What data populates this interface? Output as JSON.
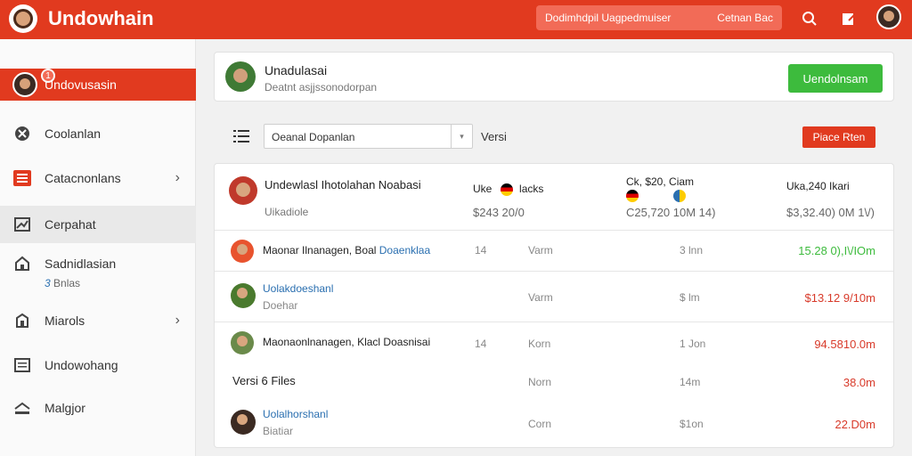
{
  "header": {
    "brand": "Undowhain",
    "search_placeholder": "Dodimhdpil Uagpedmuiser",
    "search_scope": "Cetnan Bac",
    "icons": [
      "search-icon",
      "edit-icon",
      "avatar"
    ]
  },
  "sidebar": {
    "items": [
      {
        "label": "Undovusasin",
        "icon": "avatar",
        "badge": "1",
        "active": true
      },
      {
        "label": "Coolanlan",
        "icon": "tools-icon"
      },
      {
        "label": "Catacnonlans",
        "icon": "list-icon",
        "chevron": true
      },
      {
        "label": "Cerpahat",
        "icon": "chart-icon",
        "hover": true
      },
      {
        "label": "Sadnidlasian",
        "sub": "Bnlas",
        "sub_prefix": "3",
        "icon": "home-icon"
      },
      {
        "label": "Miarols",
        "icon": "building-icon",
        "chevron": true
      },
      {
        "label": "Undowohang",
        "icon": "document-icon"
      },
      {
        "label": "Malgjor",
        "icon": "layers-icon"
      }
    ]
  },
  "profile": {
    "name": "Unadulasai",
    "subtitle": "Deatnt asjjssonodorpan",
    "button": "Uendolnsam"
  },
  "filter": {
    "select_value": "Oeanal Dopanlan",
    "label": "Versi",
    "button": "Piace Rten"
  },
  "table": {
    "header": {
      "title": "Undewlasl Ihotolahan Noabasi",
      "subtitle": "Uikadiole",
      "col1_label": "Uke",
      "col1_suffix": "lacks",
      "col1_value": "$243 20/0",
      "col2_label": "Ck, $20, Ciam",
      "col2_value": "C25,720 10M 14)",
      "col3_label": "Uka,240 Ikari",
      "col3_value": "$3,32.40) 0M 1\\/)"
    },
    "rows": [
      {
        "name": "Maonar Ilnanagen, Boal ",
        "name_hl": "Doaenklaa",
        "sub": "",
        "c1": "14",
        "c2": "Varm",
        "c3": "3 lnn",
        "amount": "15.28 0),I\\/IOm",
        "amount_color": "#3dbb3d",
        "avatar_color": "#e8532e"
      },
      {
        "name": "",
        "name_hl": "Uolakdoeshanl",
        "sub": "Doehar",
        "c1": "",
        "c2": "Varm",
        "c3": "$ lm",
        "amount": "$13.12 9/10m",
        "amount_color": "#d83a2a",
        "avatar_color": "#4a7a2e"
      },
      {
        "name": "Maonaonlnanagen, Klacl Doasnisai",
        "name_hl": "",
        "sub": "",
        "c1": "14",
        "c2": "Korn",
        "c3": "1 Jon",
        "amount": "94.5810.0m",
        "amount_color": "#d83a2a",
        "avatar_color": "#6a8a4a"
      },
      {
        "name": "Versi 6 Files",
        "name_hl": "",
        "sub": "",
        "c1": "",
        "c2": "Norn",
        "c3": "14m",
        "amount": "38.0m",
        "amount_color": "#d83a2a",
        "avatar_color": ""
      },
      {
        "name": "",
        "name_hl": "Uolalhorshanl",
        "sub": "Biatiar",
        "c1": "",
        "c2": "Corn",
        "c3": "$1on",
        "amount": "22.D0m",
        "amount_color": "#d83a2a",
        "avatar_color": "#3b2a22"
      }
    ]
  }
}
